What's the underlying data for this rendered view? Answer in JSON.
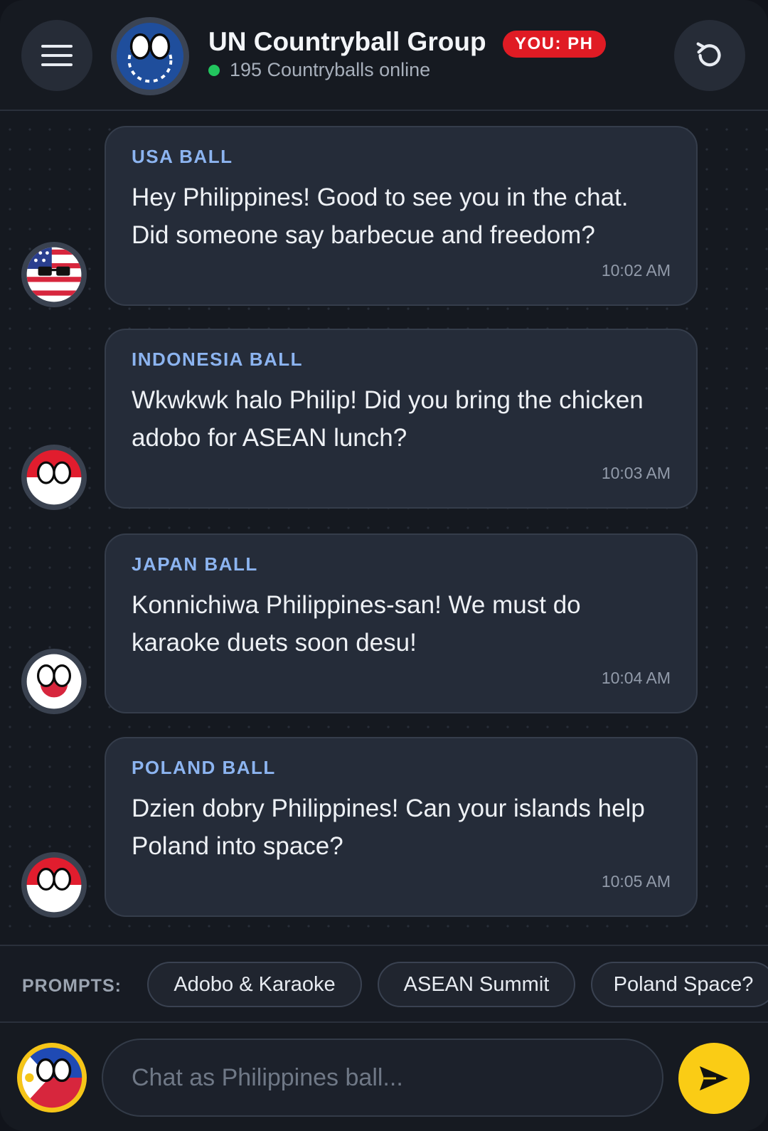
{
  "header": {
    "title": "UN Countryball Group",
    "badge": "YOU: PH",
    "status": "195 Countryballs online",
    "menu_icon": "hamburger-menu-icon",
    "refresh_icon": "refresh-icon",
    "online_color": "#22c55e",
    "badge_color": "#e01b24"
  },
  "messages": [
    {
      "sender": "USA BALL",
      "text": "Hey Philippines! Good to see you in the chat. Did someone say barbecue and freedom?",
      "time": "10:02 AM",
      "avatar": "usa-ball-avatar"
    },
    {
      "sender": "INDONESIA BALL",
      "text": "Wkwkwk halo Philip! Did you bring the chicken adobo for ASEAN lunch?",
      "time": "10:03 AM",
      "avatar": "indonesia-ball-avatar"
    },
    {
      "sender": "JAPAN BALL",
      "text": "Konnichiwa Philippines-san! We must do karaoke duets soon desu!",
      "time": "10:04 AM",
      "avatar": "japan-ball-avatar"
    },
    {
      "sender": "POLAND BALL",
      "text": "Dzien dobry Philippines! Can your islands help Poland into space?",
      "time": "10:05 AM",
      "avatar": "poland-ball-avatar"
    }
  ],
  "prompts": {
    "label": "PROMPTS:",
    "items": [
      "Adobo & Karaoke",
      "ASEAN Summit",
      "Poland Space?"
    ]
  },
  "composer": {
    "placeholder": "Chat as Philippines ball...",
    "value": "",
    "send_icon": "send-icon",
    "accent_color": "#facc15"
  }
}
